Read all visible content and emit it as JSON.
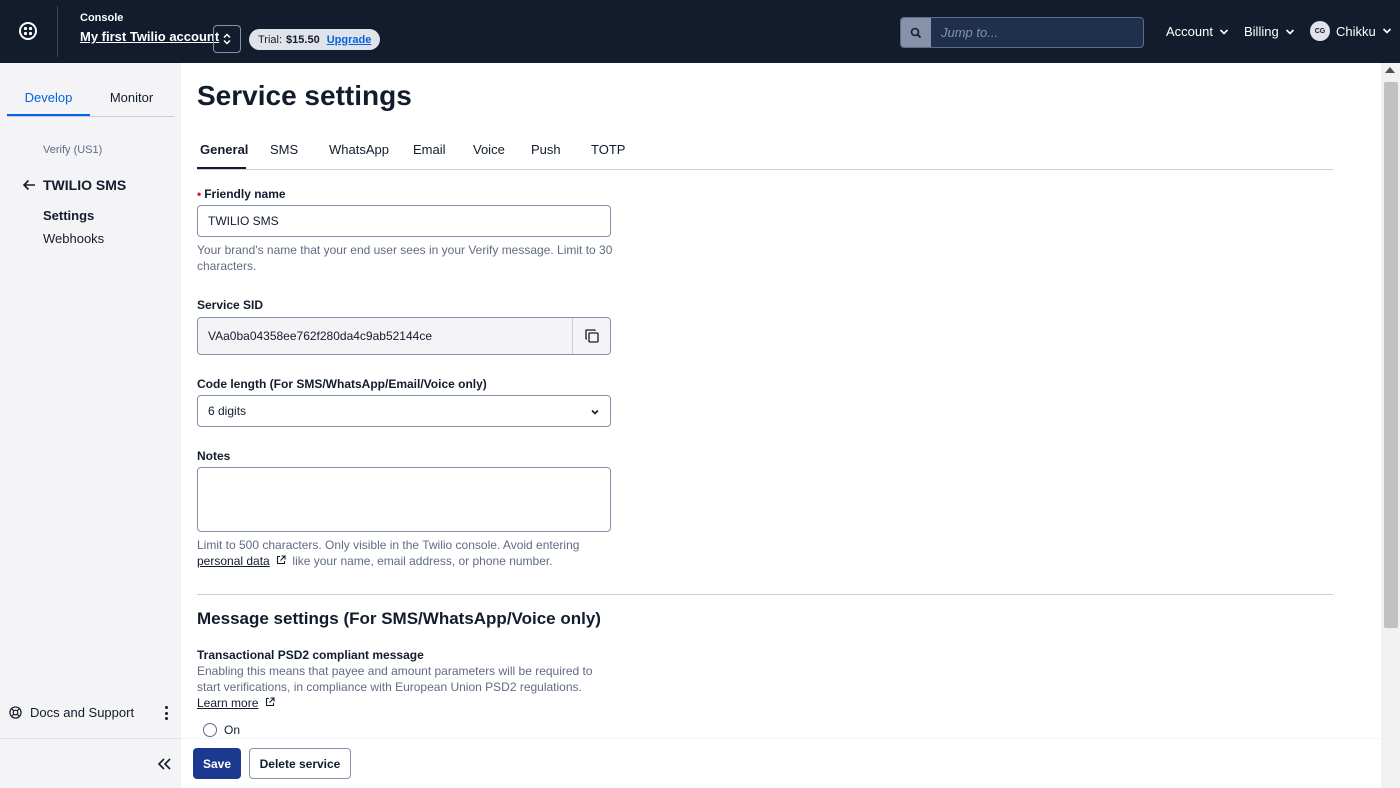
{
  "topbar": {
    "console_label": "Console",
    "account_name": "My first Twilio account",
    "trial_label": "Trial:",
    "trial_balance": "$15.50",
    "upgrade_label": "Upgrade",
    "search_placeholder": "Jump to...",
    "nav_account": "Account",
    "nav_billing": "Billing",
    "user_initials": "CG",
    "user_name": "Chikku"
  },
  "sidebar": {
    "tabs": [
      {
        "label": "Develop",
        "active": true
      },
      {
        "label": "Monitor",
        "active": false
      }
    ],
    "breadcrumb": "Verify (US1)",
    "service_name": "TWILIO SMS",
    "links": [
      {
        "label": "Settings",
        "active": true
      },
      {
        "label": "Webhooks",
        "active": false
      }
    ],
    "docs_label": "Docs and Support"
  },
  "main": {
    "title": "Service settings",
    "tabs": [
      "General",
      "SMS",
      "WhatsApp",
      "Email",
      "Voice",
      "Push",
      "TOTP"
    ],
    "active_tab": "General",
    "friendly_name": {
      "label": "Friendly name",
      "value": "TWILIO SMS",
      "help": "Your brand's name that your end user sees in your Verify message. Limit to 30 characters."
    },
    "service_sid": {
      "label": "Service SID",
      "value": "VAa0ba04358ee762f280da4c9ab52144ce"
    },
    "code_length": {
      "label": "Code length (For SMS/WhatsApp/Email/Voice only)",
      "value": "6 digits"
    },
    "notes": {
      "label": "Notes",
      "value": "",
      "help_before": "Limit to 500 characters. Only visible in the Twilio console. Avoid entering",
      "help_link": "personal data",
      "help_after": "like your name, email address, or phone number."
    },
    "message_settings": {
      "title": "Message settings (For SMS/WhatsApp/Voice only)",
      "psd2_label": "Transactional PSD2 compliant message",
      "psd2_help": "Enabling this means that payee and amount parameters will be required to start verifications, in compliance with European Union PSD2 regulations.",
      "learn_more": "Learn more",
      "option_on": "On"
    }
  },
  "footer": {
    "save_label": "Save",
    "delete_label": "Delete service"
  },
  "colors": {
    "topbar_bg": "#121c2d",
    "primary_button": "#1b3a8f",
    "active_tab": "#0263e0",
    "sidebar_bg": "#f4f4f6"
  }
}
